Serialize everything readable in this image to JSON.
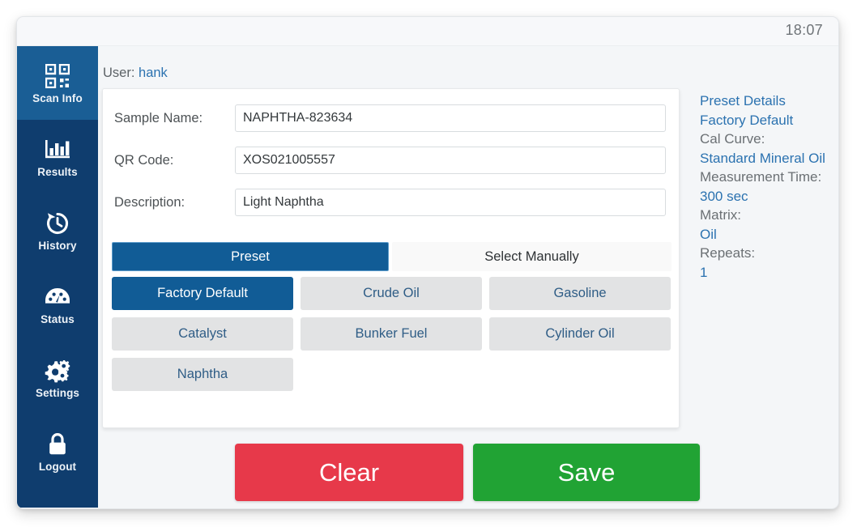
{
  "window": {
    "clock": "18:07"
  },
  "sidebar": {
    "items": [
      {
        "label": "Scan Info",
        "icon": "qr-code-icon",
        "active": true
      },
      {
        "label": "Results",
        "icon": "bar-chart-icon",
        "active": false
      },
      {
        "label": "History",
        "icon": "history-clock-icon",
        "active": false
      },
      {
        "label": "Status",
        "icon": "gauge-icon",
        "active": false
      },
      {
        "label": "Settings",
        "icon": "gears-icon",
        "active": false
      },
      {
        "label": "Logout",
        "icon": "lock-icon",
        "active": false
      }
    ]
  },
  "main": {
    "user_label": "User:",
    "user_name": "hank",
    "fields": [
      {
        "label": "Sample Name:",
        "value": "NAPHTHA-823634",
        "placeholder": ""
      },
      {
        "label": "QR Code:",
        "value": "XOS021005557",
        "placeholder": ""
      },
      {
        "label": "Description:",
        "value": "Light Naphtha",
        "placeholder": ""
      }
    ],
    "tabs": [
      {
        "label": "Preset",
        "active": true
      },
      {
        "label": "Select Manually",
        "active": false
      }
    ],
    "presets": [
      {
        "label": "Factory Default",
        "selected": true
      },
      {
        "label": "Crude Oil",
        "selected": false
      },
      {
        "label": "Gasoline",
        "selected": false
      },
      {
        "label": "Catalyst",
        "selected": false
      },
      {
        "label": "Bunker Fuel",
        "selected": false
      },
      {
        "label": "Cylinder Oil",
        "selected": false
      },
      {
        "label": "Naphtha",
        "selected": false
      }
    ]
  },
  "details": {
    "title": "Preset Details",
    "preset_name": "Factory Default",
    "cal_curve_label": "Cal Curve:",
    "cal_curve_value": "Standard Mineral Oil",
    "measurement_time_label": "Measurement Time:",
    "measurement_time_value": "300 sec",
    "matrix_label": "Matrix:",
    "matrix_value": "Oil",
    "repeats_label": "Repeats:",
    "repeats_value": "1"
  },
  "footer": {
    "clear_label": "Clear",
    "save_label": "Save"
  },
  "colors": {
    "sidebar": "#0f3d6e",
    "sidebar_active": "#1a5e95",
    "accent_blue": "#115c96",
    "link_blue": "#2b72b0",
    "clear_red": "#e7394a",
    "save_green": "#21a334"
  }
}
